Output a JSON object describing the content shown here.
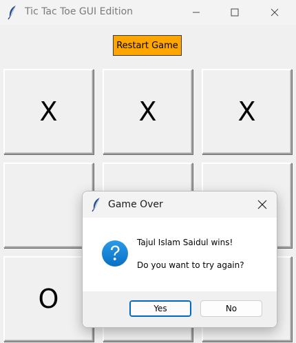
{
  "window": {
    "title": "Tic Tac Toe GUI Edition",
    "icon": "feather-icon"
  },
  "controls": {
    "restart_label": "Restart Game",
    "restart_color": "#ffa500"
  },
  "board": {
    "cells": [
      "X",
      "X",
      "X",
      "",
      "",
      "",
      "O",
      "",
      ""
    ]
  },
  "dialog": {
    "title": "Game Over",
    "icon": "question-icon",
    "message_line1": "Tajul Islam Saidul wins!",
    "message_line2": "Do you want to try again?",
    "yes_label": "Yes",
    "no_label": "No",
    "accent_color": "#0067c0"
  }
}
